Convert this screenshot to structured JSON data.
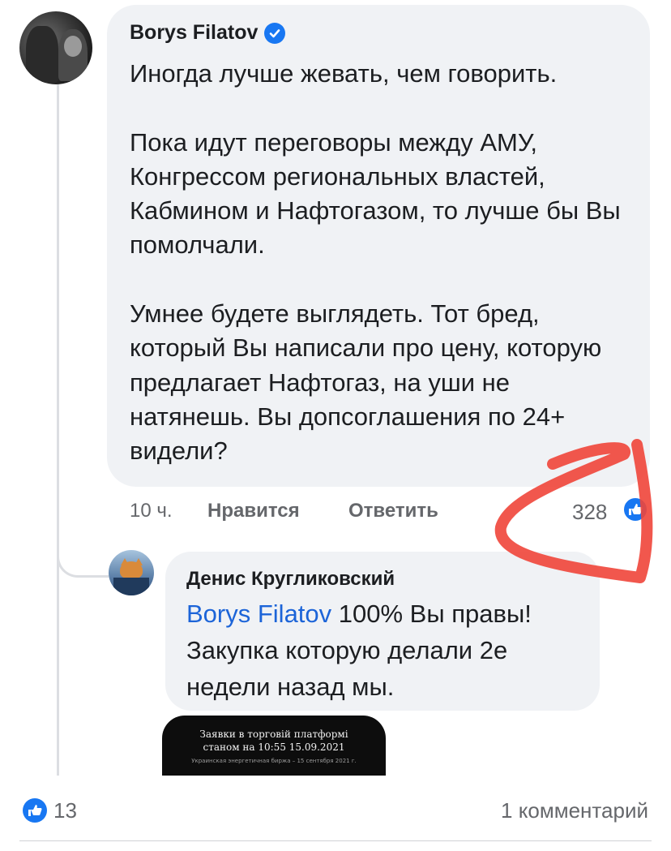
{
  "comment": {
    "author": "Borys Filatov",
    "body": "Иногда лучше жевать, чем говорить.\n\nПока идут переговоры между АМУ, Конгрессом региональных властей, Кабмином и Нафтогазом, то лучше бы Вы помолчали.\n\nУмнее будете выглядеть. Тот бред, который Вы написали про цену, которую предлагает Нафтогаз, на уши не натянешь. Вы допсоглашения по 24+ видели?",
    "time": "10 ч.",
    "like_label": "Нравится",
    "reply_label": "Ответить",
    "reaction_count": "328"
  },
  "reply": {
    "author": "Денис Кругликовский",
    "mention": "Borys Filatov",
    "body_rest": " 100% Вы правы! Закупка которую делали 2е недели назад мы.",
    "attachment": {
      "line1": "Заявки в торговій платформі",
      "line2": "станом на 10:55 15.09.2021",
      "line3": "Украинская энергетичная биржа – 15 сентября 2021 г."
    }
  },
  "footer": {
    "likes": "13",
    "comments": "1 комментарий"
  },
  "colors": {
    "bubble": "#f0f2f5",
    "accent": "#1877f2",
    "mention": "#1c64d8",
    "muted": "#65676b",
    "highlight_marker": "#f0453a"
  },
  "icons": [
    "verified-badge-icon",
    "like-reaction-icon",
    "like-badge-icon"
  ]
}
